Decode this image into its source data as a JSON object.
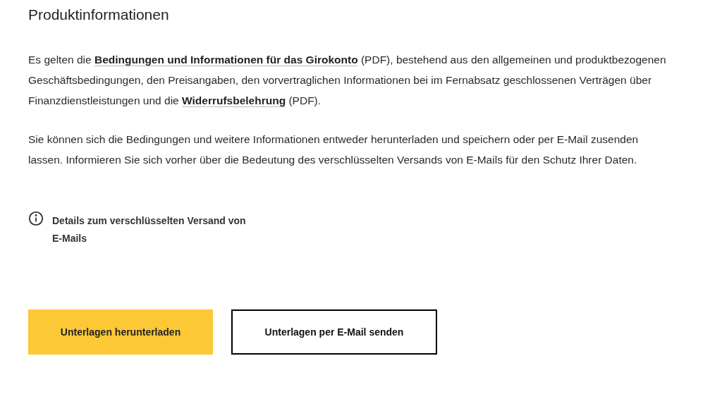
{
  "title": "Produktinformationen",
  "paragraphs": [
    [
      {
        "kind": "text",
        "text": "Es gelten die "
      },
      {
        "kind": "link",
        "text": "Bedingungen und Informationen für das Girokonto"
      },
      {
        "kind": "text",
        "text": " (PDF), bestehend aus den allgemeinen und produktbezogenen Geschäftsbedingungen, den Preisangaben, den vorvertraglichen Informationen bei im Fernabsatz geschlossenen Verträgen über Finanzdienstleistungen und die "
      },
      {
        "kind": "link",
        "text": "Widerrufsbelehrung"
      },
      {
        "kind": "text",
        "text": " (PDF)."
      }
    ],
    [
      {
        "kind": "text",
        "text": "Sie können sich die Bedingungen und weitere Informationen entweder herunterladen und speichern oder per E-Mail zusenden lassen. Informieren Sie sich vorher über die Bedeutung des verschlüsselten Versands von E-Mails für den Schutz Ihrer Daten."
      }
    ]
  ],
  "info_link": "Details zum verschlüsselten Versand von E-Mails",
  "buttons": [
    {
      "kind": "primary",
      "label": "Unterlagen herunterladen"
    },
    {
      "kind": "secondary",
      "label": "Unterlagen per E-Mail senden"
    }
  ]
}
